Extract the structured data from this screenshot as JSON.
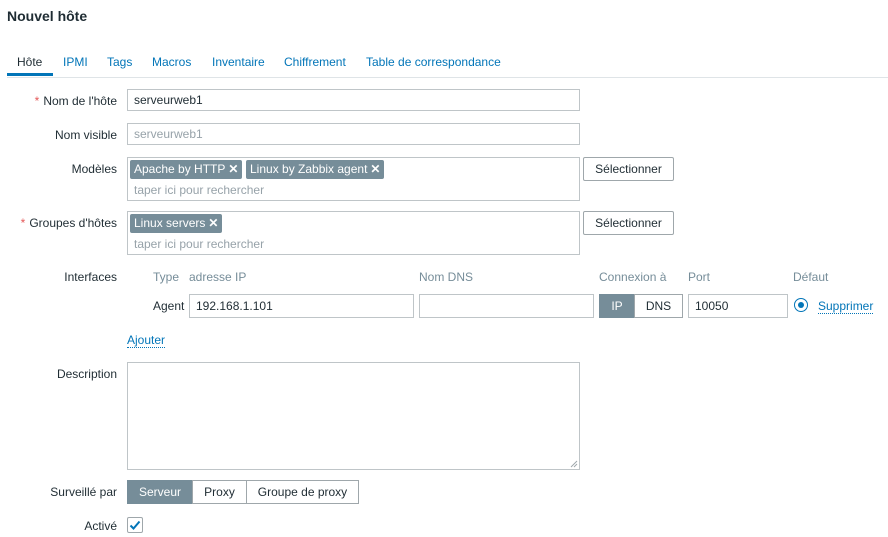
{
  "page": {
    "title": "Nouvel hôte"
  },
  "tabs": [
    {
      "label": "Hôte",
      "active": true
    },
    {
      "label": "IPMI"
    },
    {
      "label": "Tags"
    },
    {
      "label": "Macros"
    },
    {
      "label": "Inventaire"
    },
    {
      "label": "Chiffrement"
    },
    {
      "label": "Table de correspondance"
    }
  ],
  "form": {
    "host_name": {
      "label": "Nom de l'hôte",
      "required_mark": "*",
      "value": "serveurweb1"
    },
    "visible_name": {
      "label": "Nom visible",
      "placeholder": "serveurweb1"
    },
    "templates": {
      "label": "Modèles",
      "chips": [
        "Apache by HTTP",
        "Linux by Zabbix agent"
      ],
      "placeholder": "taper ici pour rechercher",
      "select_label": "Sélectionner"
    },
    "host_groups": {
      "label": "Groupes d'hôtes",
      "required_mark": "*",
      "chips": [
        "Linux servers"
      ],
      "placeholder": "taper ici pour rechercher",
      "select_label": "Sélectionner"
    },
    "interfaces": {
      "label": "Interfaces",
      "headers": {
        "type": "Type",
        "ip": "adresse IP",
        "dns": "Nom DNS",
        "connect": "Connexion à",
        "port": "Port",
        "default": "Défaut"
      },
      "rows": [
        {
          "type": "Agent",
          "ip": "192.168.1.101",
          "dns": "",
          "connect_options": [
            "IP",
            "DNS"
          ],
          "connect_selected": "IP",
          "port": "10050",
          "default": true,
          "remove_label": "Supprimer"
        }
      ],
      "add_label": "Ajouter"
    },
    "description": {
      "label": "Description",
      "value": ""
    },
    "monitored_by": {
      "label": "Surveillé par",
      "options": [
        "Serveur",
        "Proxy",
        "Groupe de proxy"
      ],
      "selected": "Serveur"
    },
    "enabled": {
      "label": "Activé",
      "checked": true
    }
  },
  "icons": {
    "chip_remove": "close-icon",
    "resize": "resize-grip-icon",
    "check": "check-icon"
  },
  "colors": {
    "accent": "#0275b8",
    "chip_bg": "#768d99",
    "required": "#e45959",
    "placeholder": "#97a2a9"
  }
}
